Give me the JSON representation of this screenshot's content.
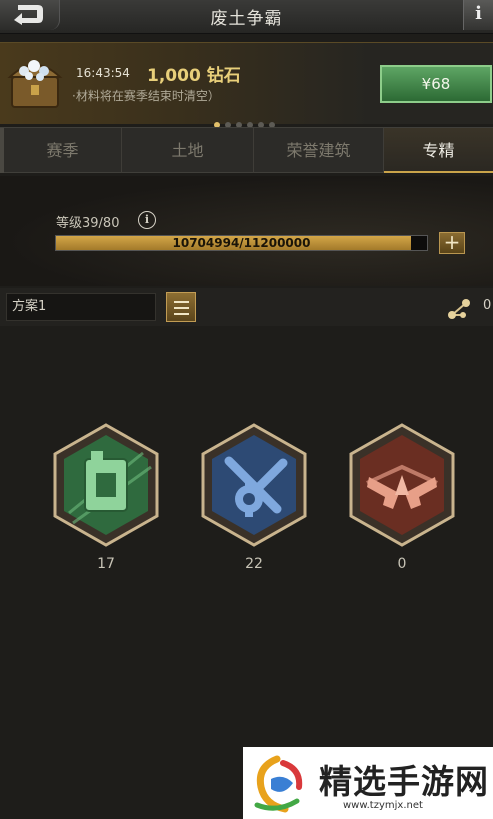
{
  "header": {
    "title": "废土争霸",
    "info_label": "i",
    "back_icon": "back-arrow-icon"
  },
  "promo": {
    "time": "16:43:54",
    "amount": "1,000 钻石",
    "note": "·材料将在赛季结束时清空）",
    "price": "¥68",
    "page_count": 6,
    "active_page": 0,
    "icon": "treasure-chest-icon"
  },
  "tabs": [
    {
      "label": "赛季"
    },
    {
      "label": "土地"
    },
    {
      "label": "荣誉建筑"
    },
    {
      "label": "专精"
    }
  ],
  "active_tab": 3,
  "level": {
    "label": "等级39/80",
    "xp_text": "10704994/11200000",
    "xp_current": 10704994,
    "xp_max": 11200000,
    "plus_label": "+"
  },
  "plan": {
    "name": "方案1",
    "share_count": "0"
  },
  "specializations": [
    {
      "icon": "fuel-can-icon",
      "count": "17",
      "color": "#3f7a4c"
    },
    {
      "icon": "wrench-gear-icon",
      "count": "22",
      "color": "#3c5e8e"
    },
    {
      "icon": "crossed-guns-icon",
      "count": "0",
      "color": "#8c4232"
    }
  ],
  "watermark": {
    "title": "精选手游网",
    "url": "www.tzymjx.net"
  }
}
